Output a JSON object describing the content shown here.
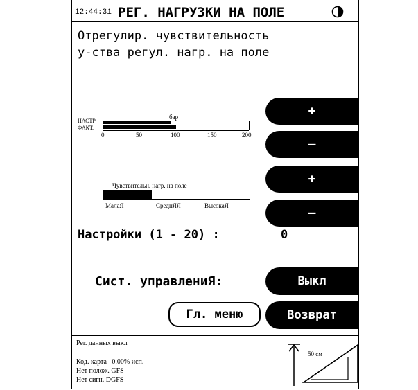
{
  "header": {
    "time": "12:44:31",
    "title": "РЕГ. НАГРУЗКИ НА ПОЛЕ",
    "status_icon": "half-circle-icon"
  },
  "instruction": {
    "line1": "Отрегулир. чувствительность",
    "line2": "у-ства регул. нагр. на поле"
  },
  "pressure_gauge": {
    "unit_label": "бар",
    "set_label": "НАСТР",
    "actual_label": "ФАКТ.",
    "set_value": 93,
    "actual_value": 100,
    "scale_max": 200,
    "ticks": [
      "0",
      "50",
      "100",
      "150",
      "200"
    ]
  },
  "sensitivity_gauge": {
    "title": "Чувствительн. нагр. на поле",
    "level": 0.33,
    "ticks": [
      "МалаЯ",
      "СреднЯЯ",
      "ВысокаЯ"
    ]
  },
  "buttons": {
    "pressure_plus": "+",
    "pressure_minus": "–",
    "sensitivity_plus": "+",
    "sensitivity_minus": "–",
    "control_toggle": "Выкл",
    "back": "Возврат",
    "main_menu": "Гл. меню"
  },
  "settings": {
    "label": "Настройки (1 - 20) :",
    "value": "0"
  },
  "control_system": {
    "label": "Сист. управлениЯ:"
  },
  "footer": {
    "line1": "Рег. данных выкл",
    "line2": "Код. карта   0.00% исп.",
    "line3": "Нет полож. GFS",
    "line4": "Нет сигн. DGFS",
    "depth_label": "50 см"
  }
}
